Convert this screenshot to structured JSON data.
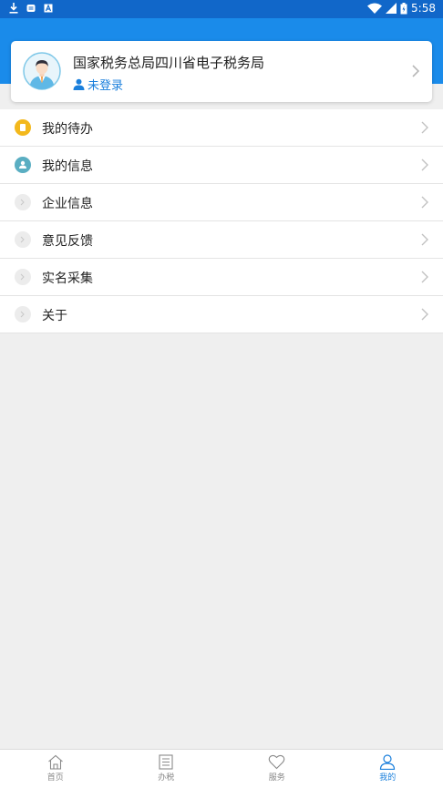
{
  "status_bar": {
    "time": "5:58",
    "left_icons": [
      "download-icon",
      "notification-icon",
      "app-a-icon"
    ],
    "right_icons": [
      "wifi-icon",
      "signal-icon",
      "battery-icon"
    ]
  },
  "colors": {
    "header_blue": "#1a8bea",
    "status_blue": "#1167c9",
    "accent_blue": "#1a7fdc",
    "todo_icon": "#f3b81c",
    "info_icon": "#5aaec2"
  },
  "profile": {
    "org_name": "国家税务总局四川省电子税务局",
    "login_status": "未登录"
  },
  "menu": {
    "items": [
      {
        "label": "我的待办",
        "icon": "todo-icon"
      },
      {
        "label": "我的信息",
        "icon": "user-info-icon"
      },
      {
        "label": "企业信息",
        "icon": "company-info-icon"
      },
      {
        "label": "意见反馈",
        "icon": "feedback-icon"
      },
      {
        "label": "实名采集",
        "icon": "real-name-icon"
      },
      {
        "label": "关于",
        "icon": "about-icon"
      }
    ]
  },
  "tabs": [
    {
      "label": "首页",
      "icon": "home-icon",
      "active": false
    },
    {
      "label": "办税",
      "icon": "tax-list-icon",
      "active": false
    },
    {
      "label": "服务",
      "icon": "heart-icon",
      "active": false
    },
    {
      "label": "我的",
      "icon": "person-icon",
      "active": true
    }
  ]
}
